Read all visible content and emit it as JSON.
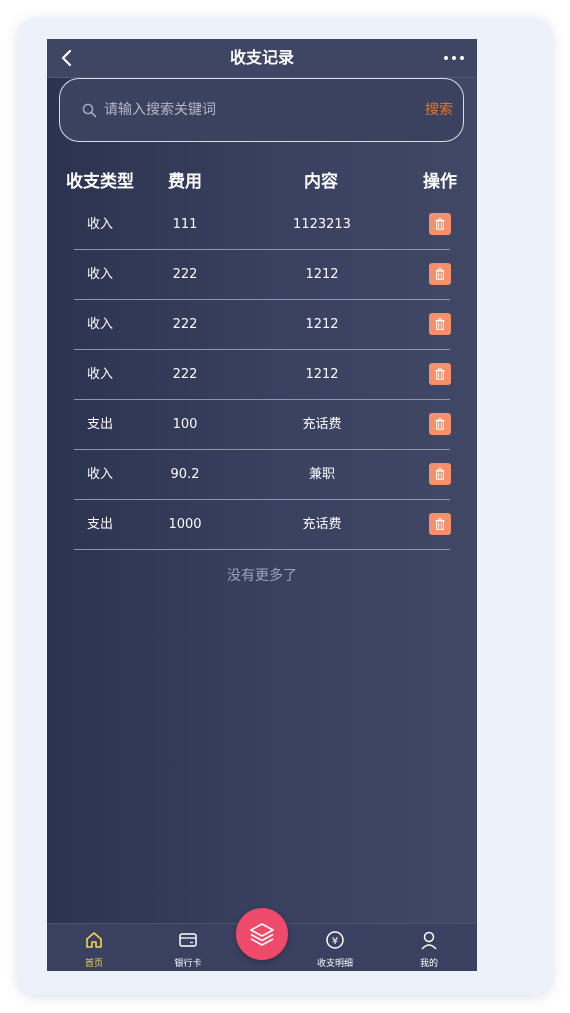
{
  "header": {
    "title": "收支记录"
  },
  "search": {
    "placeholder": "请输入搜索关键词",
    "button_label": "搜索"
  },
  "table": {
    "columns": [
      "收支类型",
      "费用",
      "内容",
      "操作"
    ],
    "rows": [
      {
        "type": "收入",
        "fee": "111",
        "content": "1123213"
      },
      {
        "type": "收入",
        "fee": "222",
        "content": "1212"
      },
      {
        "type": "收入",
        "fee": "222",
        "content": "1212"
      },
      {
        "type": "收入",
        "fee": "222",
        "content": "1212"
      },
      {
        "type": "支出",
        "fee": "100",
        "content": "充话费"
      },
      {
        "type": "收入",
        "fee": "90.2",
        "content": "兼职"
      },
      {
        "type": "支出",
        "fee": "1000",
        "content": "充话费"
      }
    ]
  },
  "list_end": "没有更多了",
  "tabbar": {
    "items": [
      {
        "label": "首页",
        "icon": "home-icon",
        "active": true
      },
      {
        "label": "银行卡",
        "icon": "bank-card-icon",
        "active": false
      },
      {
        "label": "收支明细",
        "icon": "yen-circle-icon",
        "active": false
      },
      {
        "label": "我的",
        "icon": "user-icon",
        "active": false
      }
    ],
    "center_icon": "layers-icon"
  },
  "colors": {
    "accent_orange": "#f0731e",
    "delete_button": "#f5906a",
    "fab": "#ef4a6a",
    "active_tab": "#f7d44a",
    "background": "#353c59"
  }
}
